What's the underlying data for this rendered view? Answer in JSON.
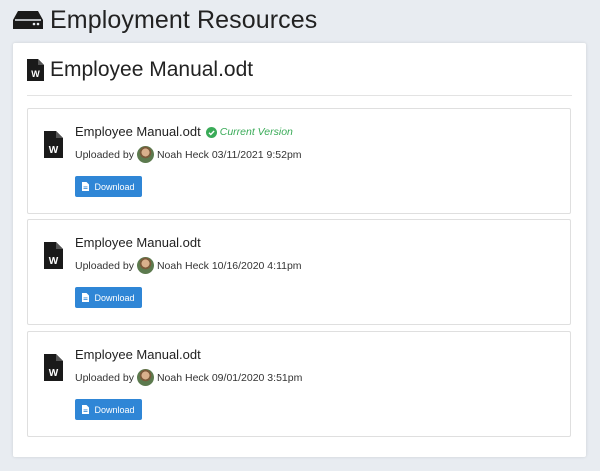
{
  "page": {
    "title": "Employment Resources"
  },
  "document": {
    "title": "Employee Manual.odt"
  },
  "versions": [
    {
      "filename": "Employee Manual.odt",
      "badge": "Current Version",
      "uploaded_by_label": "Uploaded by",
      "user": "Noah Heck",
      "datetime": "03/11/2021 9:52pm",
      "download_label": "Download"
    },
    {
      "filename": "Employee Manual.odt",
      "uploaded_by_label": "Uploaded by",
      "user": "Noah Heck",
      "datetime": "10/16/2020 4:11pm",
      "download_label": "Download"
    },
    {
      "filename": "Employee Manual.odt",
      "uploaded_by_label": "Uploaded by",
      "user": "Noah Heck",
      "datetime": "09/01/2020 3:51pm",
      "download_label": "Download"
    }
  ],
  "colors": {
    "accent": "#2f86d6",
    "success": "#3aab58",
    "background": "#e8ecf1"
  },
  "icons": {
    "header": "hdd-icon",
    "file": "word-file-icon",
    "badge": "check-circle-icon",
    "download": "file-icon"
  }
}
